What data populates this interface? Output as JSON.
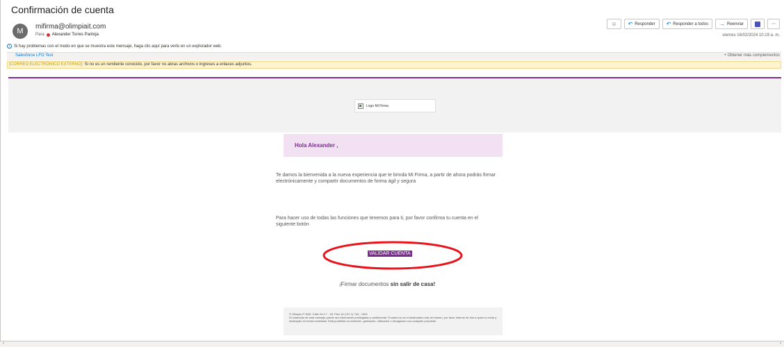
{
  "email": {
    "subject": "Confirmación de cuenta",
    "avatar_letter": "M",
    "sender": "mifirma@olimpiait.com",
    "to_label": "Para",
    "to_name": "Alexander Torres Pantoja",
    "date": "viernes 16/02/2024 10:19 a. m."
  },
  "toolbar": {
    "emoji_icon": "☺",
    "reply": "Responder",
    "reply_all": "Responder a todos",
    "forward": "Reenviar",
    "more": "⋯"
  },
  "notices": {
    "problems": "Si hay problemas con el modo en que se muestra este mensaje, haga clic aquí para verlo en un explorador web.",
    "addin": "Salesforce LFO Test",
    "more_addins": "Obtener más complementos",
    "external_tag": "[CORREO ELECTRÓNICO EXTERNO]:",
    "external_text": " Si no es un remitente conocido, por favor no abras archivos o ingreses a enlaces adjuntos."
  },
  "body": {
    "logo_alt": "Logo Mi Firma",
    "greeting": "Hola Alexander ,",
    "p1": "Te damos la bienvenida a la nueva experiencia que te brinda Mi Firma, a partir de ahora podrás firmar electrónicamente y compartir documentos de forma ágil y segura",
    "p2": "Para hacer uso de todas las funciones que tenemos para ti, por favor confirma tu cuenta en el siguiente botón",
    "cta": "VALIDAR CUENTA",
    "tagline_pre": "¡Firmar documentos ",
    "tagline_bold": "sin salir de casa!",
    "footer_1": "© Olimpia IT SAS. Calle 24 # 7 - 43. Piso 16 (+57 1) 744 - 1000",
    "footer_2": "El contenido de este mensaje puede ser información privilegiada y confidencial. Si usted no es el destinatario real del mismo, por favor informe de ello a quien lo envía y destrúyalo en forma inmediata. Está prohibida su retención, grabación, utilización o divulgación con cualquier propósito."
  },
  "colors": {
    "brand_purple": "#7b2d8e",
    "annotation_red": "#e8141b",
    "outlook_blue": "#0078d4"
  }
}
